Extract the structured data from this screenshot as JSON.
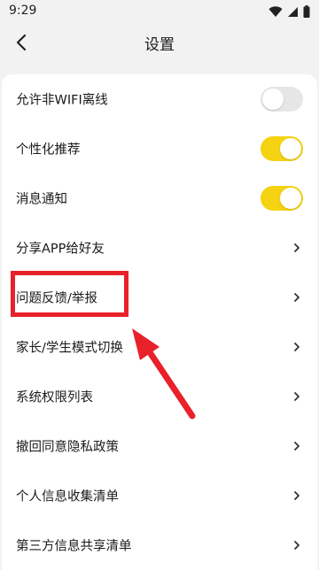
{
  "status_bar": {
    "time": "9:29",
    "icons": [
      "wifi-icon",
      "signal-icon",
      "battery-icon"
    ]
  },
  "nav": {
    "title": "设置",
    "back_icon": "back-arrow-icon"
  },
  "settings": {
    "items": [
      {
        "label": "允许非WIFI离线",
        "control": "toggle",
        "on": false
      },
      {
        "label": "个性化推荐",
        "control": "toggle",
        "on": true
      },
      {
        "label": "消息通知",
        "control": "toggle",
        "on": true
      },
      {
        "label": "分享APP给好友",
        "control": "chevron"
      },
      {
        "label": "问题反馈/举报",
        "control": "chevron",
        "highlighted": true
      },
      {
        "label": "家长/学生模式切换",
        "control": "chevron"
      },
      {
        "label": "系统权限列表",
        "control": "chevron"
      },
      {
        "label": "撤回同意隐私政策",
        "control": "chevron"
      },
      {
        "label": "个人信息收集清单",
        "control": "chevron"
      },
      {
        "label": "第三方信息共享清单",
        "control": "chevron"
      }
    ]
  },
  "colors": {
    "toggle_on": "#f5d312",
    "toggle_off": "#e6e6e6",
    "annotation_red": "#e8212a",
    "background": "#f2f2f2"
  }
}
